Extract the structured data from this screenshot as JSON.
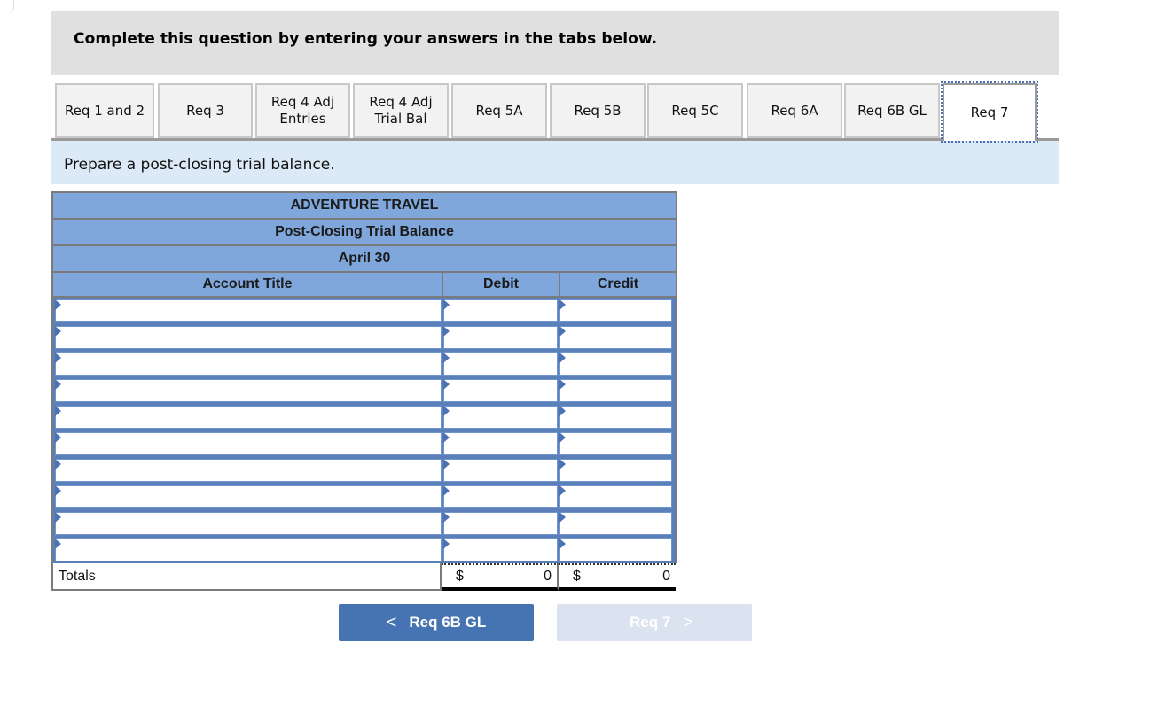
{
  "instructions": "Complete this question by entering your answers in the tabs below.",
  "tabs": [
    {
      "label": "Req 1 and 2",
      "active": false
    },
    {
      "label": "Req 3",
      "active": false
    },
    {
      "label": "Req 4 Adj\nEntries",
      "active": false
    },
    {
      "label": "Req 4 Adj\nTrial Bal",
      "active": false
    },
    {
      "label": "Req 5A",
      "active": false
    },
    {
      "label": "Req 5B",
      "active": false
    },
    {
      "label": "Req 5C",
      "active": false
    },
    {
      "label": "Req 6A",
      "active": false
    },
    {
      "label": "Req 6B GL",
      "active": false
    },
    {
      "label": "Req 7",
      "active": true
    }
  ],
  "prompt": "Prepare a post-closing trial balance.",
  "statement": {
    "company": "ADVENTURE TRAVEL",
    "title": "Post-Closing Trial Balance",
    "date": "April 30",
    "columns": {
      "account": "Account Title",
      "debit": "Debit",
      "credit": "Credit"
    },
    "rows": [
      {
        "account": "",
        "debit": "",
        "credit": ""
      },
      {
        "account": "",
        "debit": "",
        "credit": ""
      },
      {
        "account": "",
        "debit": "",
        "credit": ""
      },
      {
        "account": "",
        "debit": "",
        "credit": ""
      },
      {
        "account": "",
        "debit": "",
        "credit": ""
      },
      {
        "account": "",
        "debit": "",
        "credit": ""
      },
      {
        "account": "",
        "debit": "",
        "credit": ""
      },
      {
        "account": "",
        "debit": "",
        "credit": ""
      },
      {
        "account": "",
        "debit": "",
        "credit": ""
      },
      {
        "account": "",
        "debit": "",
        "credit": ""
      }
    ],
    "totals": {
      "label": "Totals",
      "currency": "$",
      "debit": "0",
      "credit": "0"
    }
  },
  "nav": {
    "prev": {
      "label": "Req 6B GL",
      "icon": "chevron-left-icon",
      "glyph": "<"
    },
    "next": {
      "label": "Req 7",
      "icon": "chevron-right-icon",
      "glyph": ">",
      "disabled": true
    }
  },
  "colors": {
    "accent": "#4673b2",
    "header_bg": "#7fa7dc",
    "panel_bg": "#dceaf7"
  }
}
